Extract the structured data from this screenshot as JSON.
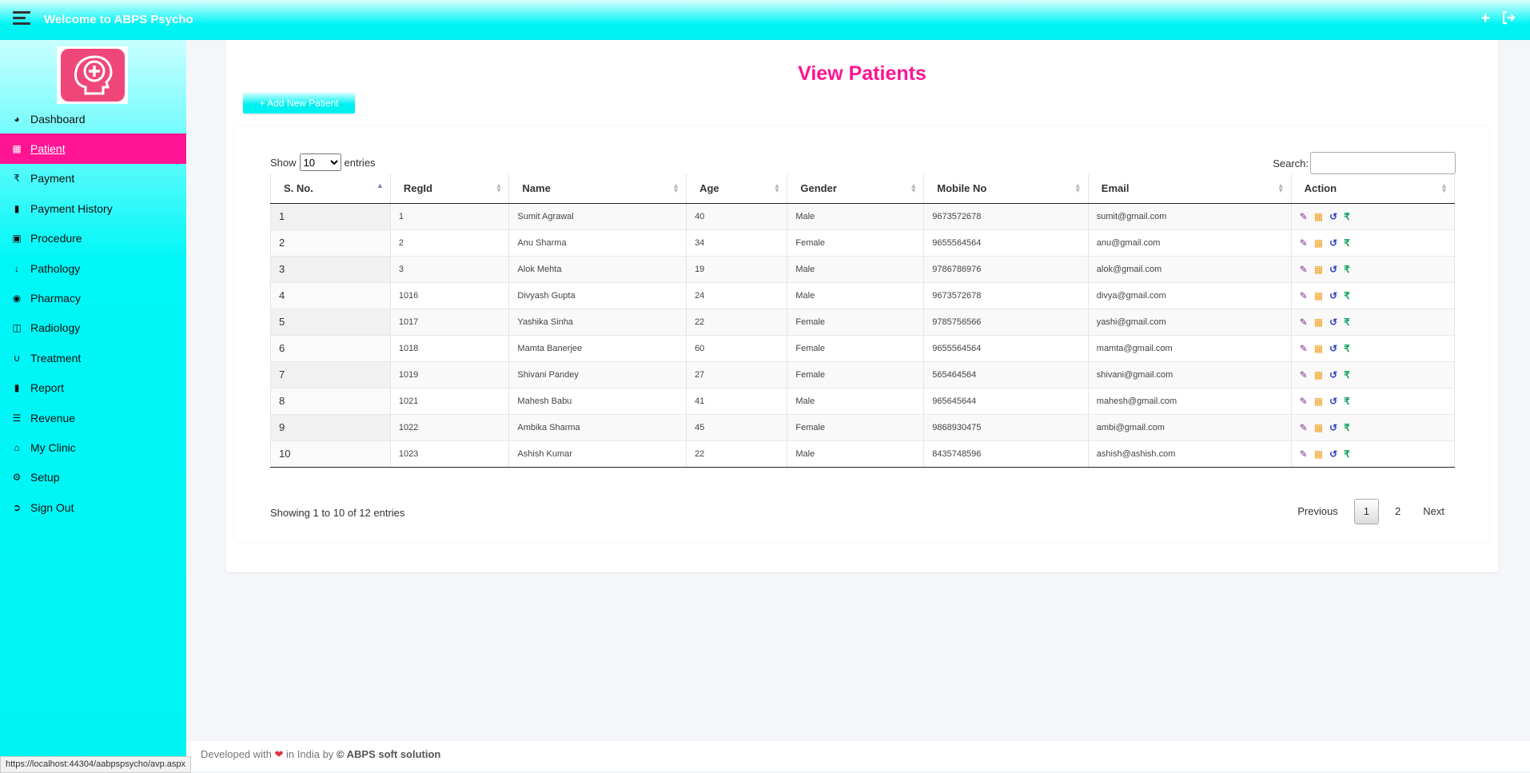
{
  "header": {
    "title": "Welcome to ABPS Psycho"
  },
  "sidebar": {
    "items": [
      {
        "label": "Dashboard",
        "icon": "dashboard-icon"
      },
      {
        "label": "Patient",
        "icon": "users-icon"
      },
      {
        "label": "Payment",
        "icon": "rupee-icon"
      },
      {
        "label": "Payment History",
        "icon": "file-icon"
      },
      {
        "label": "Procedure",
        "icon": "procedure-icon"
      },
      {
        "label": "Pathology",
        "icon": "pathology-icon"
      },
      {
        "label": "Pharmacy",
        "icon": "pharmacy-icon"
      },
      {
        "label": "Radiology",
        "icon": "radiology-icon"
      },
      {
        "label": "Treatment",
        "icon": "stethoscope-icon"
      },
      {
        "label": "Report",
        "icon": "report-icon"
      },
      {
        "label": "Revenue",
        "icon": "revenue-icon"
      },
      {
        "label": "My Clinic",
        "icon": "home-icon"
      },
      {
        "label": "Setup",
        "icon": "gear-icon"
      },
      {
        "label": "Sign Out",
        "icon": "signout-icon"
      }
    ],
    "active_index": 1
  },
  "main": {
    "title": "View Patients",
    "add_button": "+ Add New Patient",
    "length": {
      "prefix": "Show",
      "value": "10",
      "suffix": "entries"
    },
    "search_label": "Search:",
    "columns": [
      "S. No.",
      "RegId",
      "Name",
      "Age",
      "Gender",
      "Mobile No",
      "Email",
      "Action"
    ],
    "rows": [
      [
        "1",
        "1",
        "Sumit Agrawal",
        "40",
        "Male",
        "9673572678",
        "sumit@gmail.com"
      ],
      [
        "2",
        "2",
        "Anu Sharma",
        "34",
        "Female",
        "9655564564",
        "anu@gmail.com"
      ],
      [
        "3",
        "3",
        "Alok Mehta",
        "19",
        "Male",
        "9786786976",
        "alok@gmail.com"
      ],
      [
        "4",
        "1016",
        "Divyash Gupta",
        "24",
        "Male",
        "9673572678",
        "divya@gmail.com"
      ],
      [
        "5",
        "1017",
        "Yashika Sinha",
        "22",
        "Female",
        "9785756566",
        "yashi@gmail.com"
      ],
      [
        "6",
        "1018",
        "Mamta Banerjee",
        "60",
        "Female",
        "9655564564",
        "mamta@gmail.com"
      ],
      [
        "7",
        "1019",
        "Shivani Pandey",
        "27",
        "Female",
        "565464564",
        "shivani@gmail.com"
      ],
      [
        "8",
        "1021",
        "Mahesh Babu",
        "41",
        "Male",
        "965645644",
        "mahesh@gmail.com"
      ],
      [
        "9",
        "1022",
        "Ambika Sharma",
        "45",
        "Female",
        "9868930475",
        "ambi@gmail.com"
      ],
      [
        "10",
        "1023",
        "Ashish Kumar",
        "22",
        "Male",
        "8435748596",
        "ashish@ashish.com"
      ]
    ],
    "info": "Showing 1 to 10 of 12 entries",
    "pager": {
      "previous": "Previous",
      "pages": [
        "1",
        "2"
      ],
      "next": "Next"
    }
  },
  "footer": {
    "text_before": "Developed with",
    "text_after": "in India by",
    "company": "© ABPS soft solution"
  },
  "status_url": "https://localhost:44304/aabpspsycho/avp.aspx",
  "colors": {
    "accent_cyan": "#00f4f4",
    "accent_pink": "#ff1493"
  }
}
